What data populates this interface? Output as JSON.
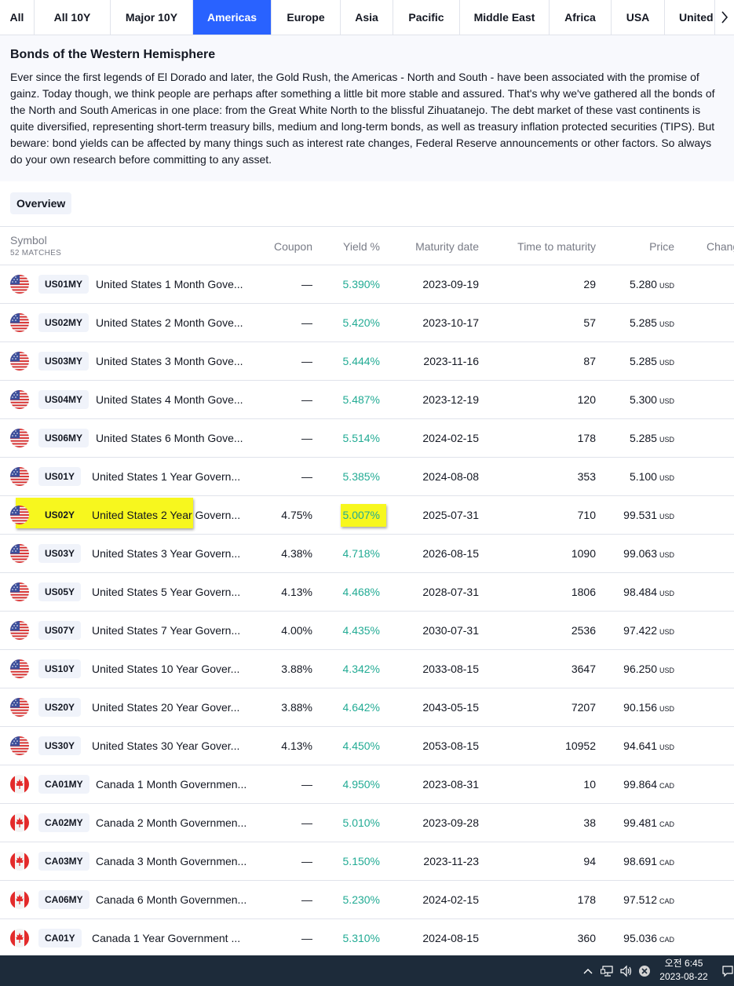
{
  "tabs": [
    {
      "label": "All",
      "active": false
    },
    {
      "label": "All 10Y",
      "active": false
    },
    {
      "label": "Major 10Y",
      "active": false
    },
    {
      "label": "Americas",
      "active": true
    },
    {
      "label": "Europe",
      "active": false
    },
    {
      "label": "Asia",
      "active": false
    },
    {
      "label": "Pacific",
      "active": false
    },
    {
      "label": "Middle East",
      "active": false
    },
    {
      "label": "Africa",
      "active": false
    },
    {
      "label": "USA",
      "active": false
    },
    {
      "label": "United",
      "active": false
    }
  ],
  "description": {
    "title": "Bonds of the Western Hemisphere",
    "body": "Ever since the first legends of El Dorado and later, the Gold Rush, the Americas - North and South - have been associated with the promise of gainz. Today though, we think people are perhaps after something a little bit more stable and assured. That's why we've gathered all the bonds of the North and South Americas in one place: from the Great White North to the blissful Zihuatanejo. The debt market of these vast continents is quite diversified, representing short-term treasury bills, medium and long-term bonds, as well as treasury inflation protected securities (TIPS). But beware: bond yields can be affected by many things such as interest rate changes, Federal Reserve announcements or other factors. So always do your own research before committing to any asset."
  },
  "overview_label": "Overview",
  "table": {
    "headers": {
      "symbol": "Symbol",
      "matches": "52 MATCHES",
      "coupon": "Coupon",
      "yield": "Yield %",
      "maturity": "Maturity date",
      "time": "Time to maturity",
      "price": "Price",
      "change": "Chang"
    },
    "rows": [
      {
        "flag": "us-flag-icon",
        "ticker": "US01MY",
        "name": "United States 1 Month Gove...",
        "coupon": "—",
        "yield": "5.390%",
        "maturity": "2023-09-19",
        "time": "29",
        "price": "5.280",
        "currency": "USD",
        "highlight": false
      },
      {
        "flag": "us-flag-icon",
        "ticker": "US02MY",
        "name": "United States 2 Month Gove...",
        "coupon": "—",
        "yield": "5.420%",
        "maturity": "2023-10-17",
        "time": "57",
        "price": "5.285",
        "currency": "USD",
        "highlight": false
      },
      {
        "flag": "us-flag-icon",
        "ticker": "US03MY",
        "name": "United States 3 Month Gove...",
        "coupon": "—",
        "yield": "5.444%",
        "maturity": "2023-11-16",
        "time": "87",
        "price": "5.285",
        "currency": "USD",
        "highlight": false
      },
      {
        "flag": "us-flag-icon",
        "ticker": "US04MY",
        "name": "United States 4 Month Gove...",
        "coupon": "—",
        "yield": "5.487%",
        "maturity": "2023-12-19",
        "time": "120",
        "price": "5.300",
        "currency": "USD",
        "highlight": false
      },
      {
        "flag": "us-flag-icon",
        "ticker": "US06MY",
        "name": "United States 6 Month Gove...",
        "coupon": "—",
        "yield": "5.514%",
        "maturity": "2024-02-15",
        "time": "178",
        "price": "5.285",
        "currency": "USD",
        "highlight": false
      },
      {
        "flag": "us-flag-icon",
        "ticker": "US01Y",
        "name": "United States 1 Year Govern...",
        "coupon": "—",
        "yield": "5.385%",
        "maturity": "2024-08-08",
        "time": "353",
        "price": "5.100",
        "currency": "USD",
        "highlight": false
      },
      {
        "flag": "us-flag-icon",
        "ticker": "US02Y",
        "name": "United States 2 Year Govern...",
        "coupon": "4.75%",
        "yield": "5.007%",
        "maturity": "2025-07-31",
        "time": "710",
        "price": "99.531",
        "currency": "USD",
        "highlight": true
      },
      {
        "flag": "us-flag-icon",
        "ticker": "US03Y",
        "name": "United States 3 Year Govern...",
        "coupon": "4.38%",
        "yield": "4.718%",
        "maturity": "2026-08-15",
        "time": "1090",
        "price": "99.063",
        "currency": "USD",
        "highlight": false
      },
      {
        "flag": "us-flag-icon",
        "ticker": "US05Y",
        "name": "United States 5 Year Govern...",
        "coupon": "4.13%",
        "yield": "4.468%",
        "maturity": "2028-07-31",
        "time": "1806",
        "price": "98.484",
        "currency": "USD",
        "highlight": false
      },
      {
        "flag": "us-flag-icon",
        "ticker": "US07Y",
        "name": "United States 7 Year Govern...",
        "coupon": "4.00%",
        "yield": "4.435%",
        "maturity": "2030-07-31",
        "time": "2536",
        "price": "97.422",
        "currency": "USD",
        "highlight": false
      },
      {
        "flag": "us-flag-icon",
        "ticker": "US10Y",
        "name": "United States 10 Year Gover...",
        "coupon": "3.88%",
        "yield": "4.342%",
        "maturity": "2033-08-15",
        "time": "3647",
        "price": "96.250",
        "currency": "USD",
        "highlight": false
      },
      {
        "flag": "us-flag-icon",
        "ticker": "US20Y",
        "name": "United States 20 Year Gover...",
        "coupon": "3.88%",
        "yield": "4.642%",
        "maturity": "2043-05-15",
        "time": "7207",
        "price": "90.156",
        "currency": "USD",
        "highlight": false
      },
      {
        "flag": "us-flag-icon",
        "ticker": "US30Y",
        "name": "United States 30 Year Gover...",
        "coupon": "4.13%",
        "yield": "4.450%",
        "maturity": "2053-08-15",
        "time": "10952",
        "price": "94.641",
        "currency": "USD",
        "highlight": false
      },
      {
        "flag": "canada-flag-icon",
        "ticker": "CA01MY",
        "name": "Canada 1 Month Governmen...",
        "coupon": "—",
        "yield": "4.950%",
        "maturity": "2023-08-31",
        "time": "10",
        "price": "99.864",
        "currency": "CAD",
        "highlight": false
      },
      {
        "flag": "canada-flag-icon",
        "ticker": "CA02MY",
        "name": "Canada 2 Month Governmen...",
        "coupon": "—",
        "yield": "5.010%",
        "maturity": "2023-09-28",
        "time": "38",
        "price": "99.481",
        "currency": "CAD",
        "highlight": false
      },
      {
        "flag": "canada-flag-icon",
        "ticker": "CA03MY",
        "name": "Canada 3 Month Governmen...",
        "coupon": "—",
        "yield": "5.150%",
        "maturity": "2023-11-23",
        "time": "94",
        "price": "98.691",
        "currency": "CAD",
        "highlight": false
      },
      {
        "flag": "canada-flag-icon",
        "ticker": "CA06MY",
        "name": "Canada 6 Month Governmen...",
        "coupon": "—",
        "yield": "5.230%",
        "maturity": "2024-02-15",
        "time": "178",
        "price": "97.512",
        "currency": "CAD",
        "highlight": false
      },
      {
        "flag": "canada-flag-icon",
        "ticker": "CA01Y",
        "name": "Canada 1 Year Government ...",
        "coupon": "—",
        "yield": "5.310%",
        "maturity": "2024-08-15",
        "time": "360",
        "price": "95.036",
        "currency": "CAD",
        "highlight": false
      }
    ]
  },
  "colors": {
    "accent": "#2962ff",
    "yield_green": "#22ab94",
    "highlight": "#f7f71e",
    "taskbar": "#1d2b3a"
  },
  "taskbar": {
    "time": "오전 6:45",
    "date": "2023-08-22",
    "icons": [
      "chevron-up-icon",
      "network-icon",
      "volume-icon",
      "close-circle-icon",
      "notification-icon"
    ]
  }
}
